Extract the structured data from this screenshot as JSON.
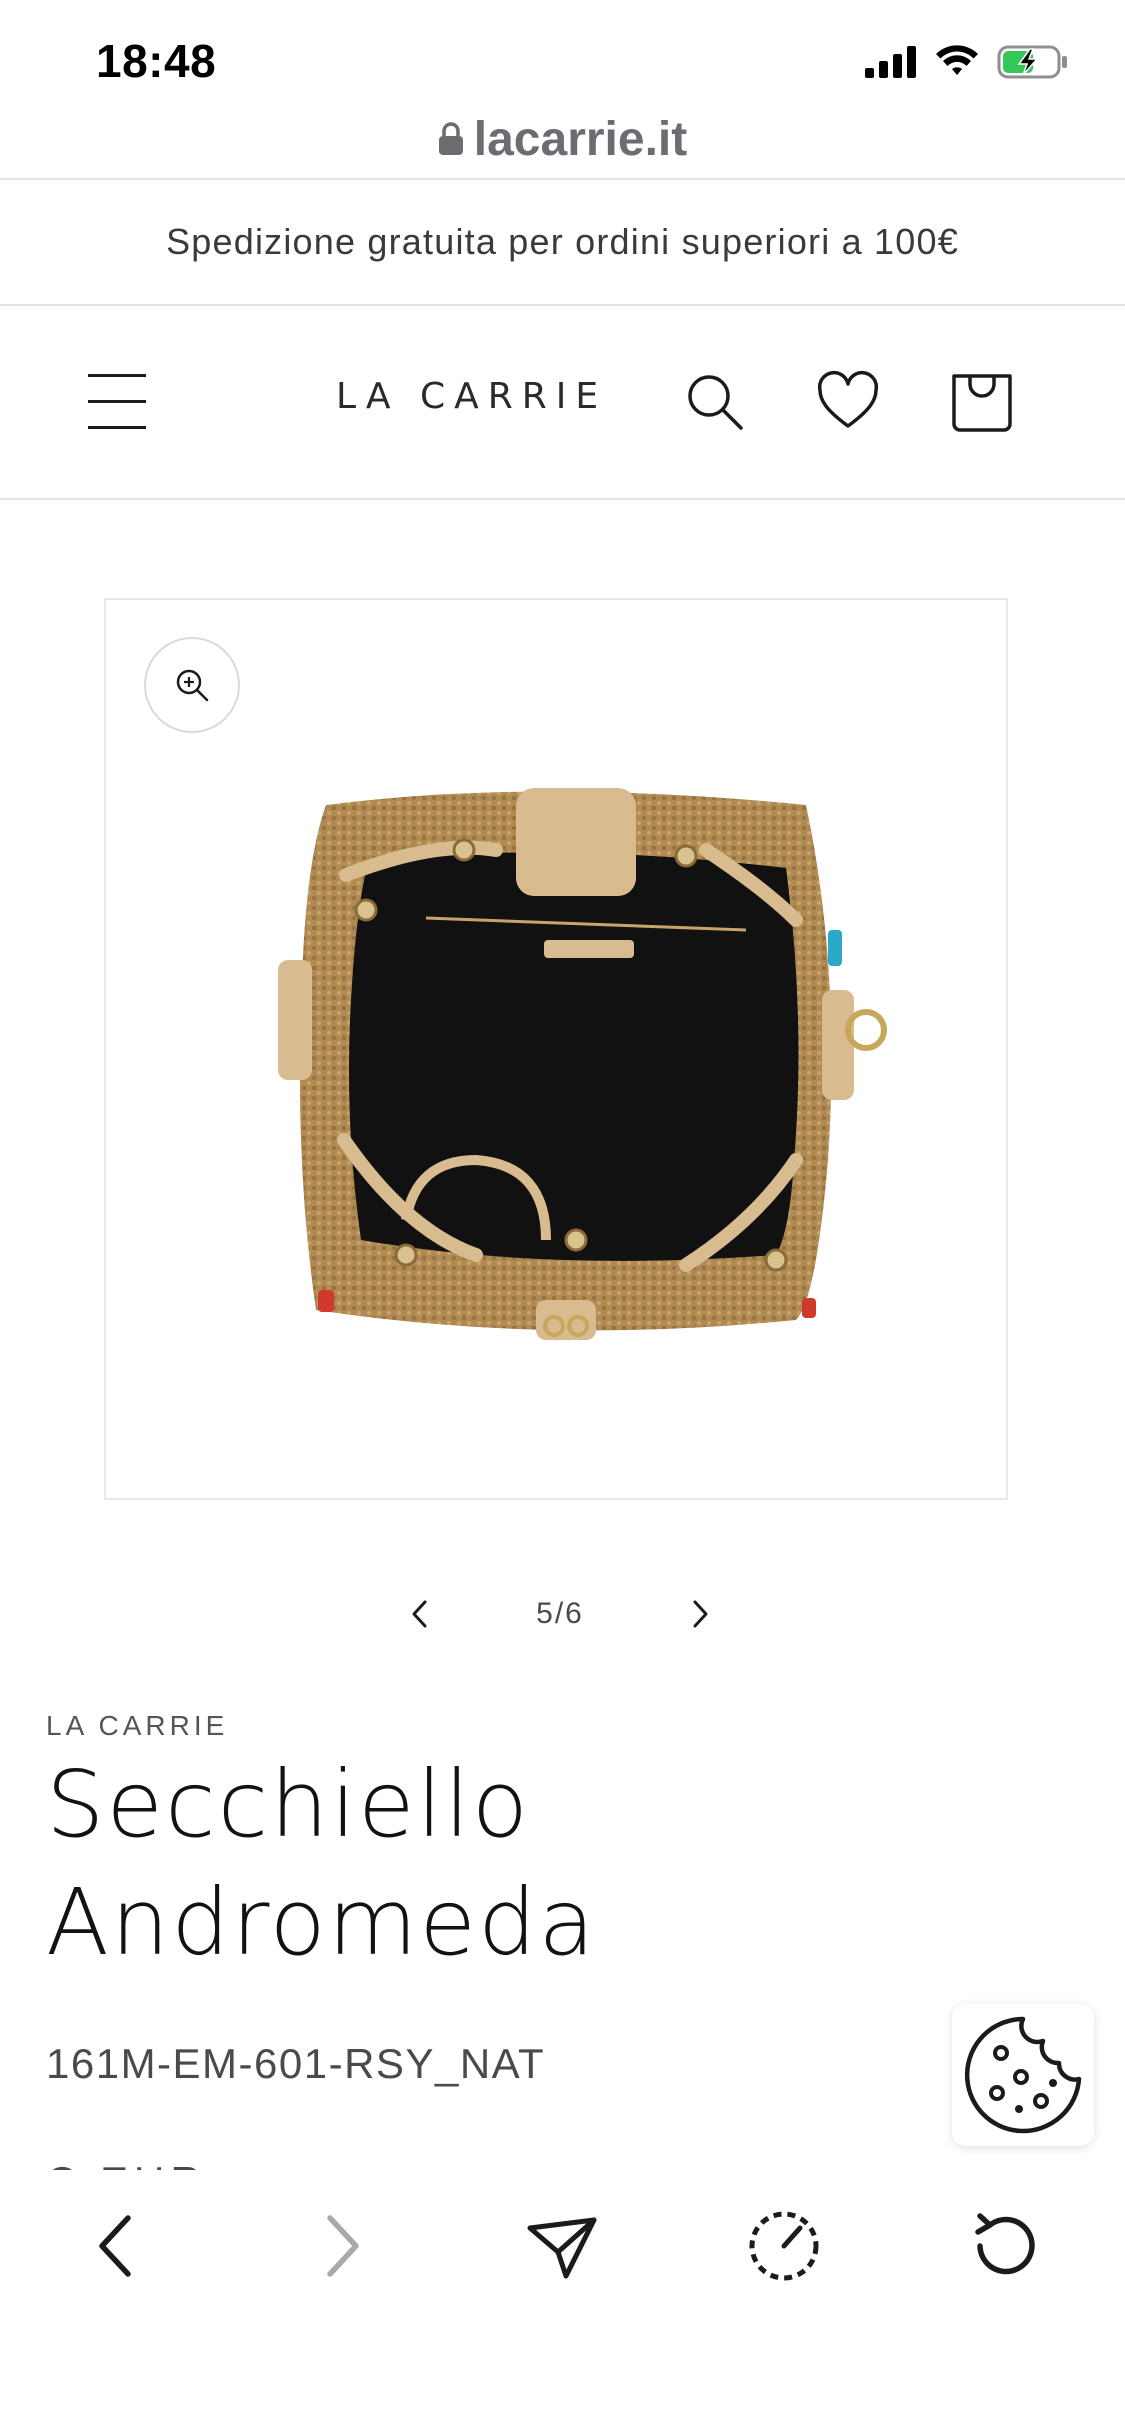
{
  "status": {
    "time": "18:48"
  },
  "browser": {
    "url": "lacarrie.it"
  },
  "announcement": "Spedizione gratuita per ordini superiori a 100€",
  "header": {
    "logo": "LA CARRIE",
    "icons": [
      "menu-icon",
      "search-icon",
      "heart-icon",
      "bag-icon"
    ]
  },
  "gallery": {
    "counter": "5/6",
    "icons": [
      "zoom-in-icon",
      "chevron-left-icon",
      "chevron-right-icon"
    ]
  },
  "product": {
    "vendor": "LA CARRIE",
    "title": "Secchiello Andromeda",
    "sku": "161M-EM-601-RSY_NAT",
    "partial_line": "C EUR"
  },
  "cookie": {
    "icon": "cookie-icon"
  },
  "toolbar": {
    "icons": [
      "back-icon",
      "forward-icon",
      "share-icon",
      "speed-icon",
      "reload-icon"
    ]
  },
  "colors": {
    "battery_green": "#34c759",
    "text": "#121212",
    "muted": "#4a4a4a",
    "bag_tan": "#b08a52",
    "bag_interior": "#111111",
    "leather": "#d8bc90"
  }
}
